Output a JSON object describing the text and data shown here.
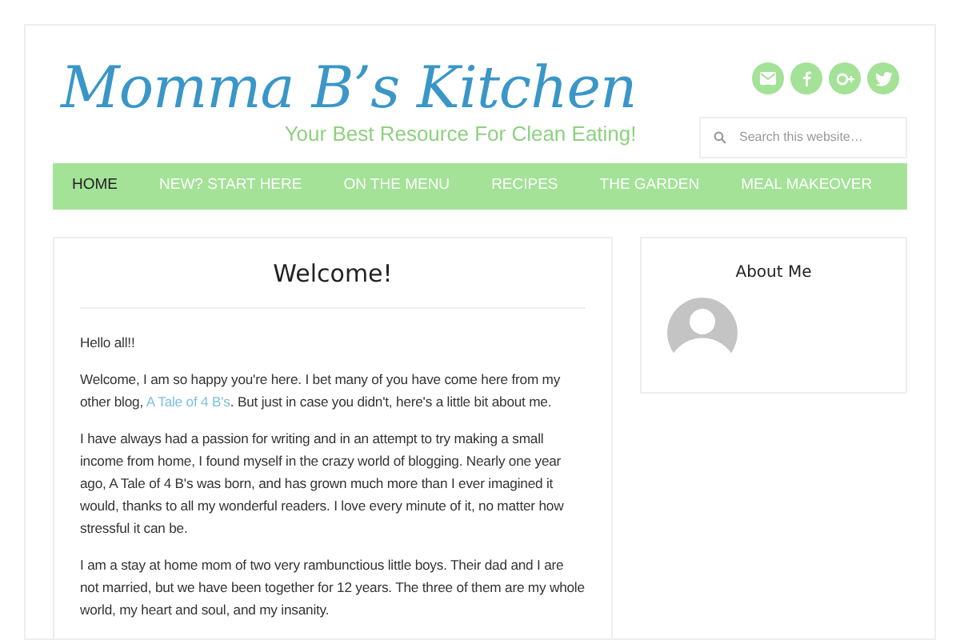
{
  "site": {
    "title": "Momma B’s Kitchen",
    "tagline": "Your Best Resource For Clean Eating!"
  },
  "social": [
    {
      "kind": "email"
    },
    {
      "kind": "facebook"
    },
    {
      "kind": "googleplus"
    },
    {
      "kind": "twitter"
    }
  ],
  "search": {
    "placeholder": "Search this website…"
  },
  "nav": [
    {
      "label": "HOME",
      "selected": true
    },
    {
      "label": "NEW? START HERE",
      "selected": false
    },
    {
      "label": "ON THE MENU",
      "selected": false
    },
    {
      "label": "RECIPES",
      "selected": false
    },
    {
      "label": "THE GARDEN",
      "selected": false
    },
    {
      "label": "MEAL MAKEOVER",
      "selected": false
    }
  ],
  "post": {
    "title": "Welcome!",
    "paragraphs": [
      [
        {
          "kind": "text",
          "text": "Hello all!!"
        }
      ],
      [
        {
          "kind": "text",
          "text": "Welcome, I am so happy you're here. I bet many of you have come here from my other blog, "
        },
        {
          "kind": "link",
          "text": "A Tale of 4 B's"
        },
        {
          "kind": "text",
          "text": ". But just in case you didn't, here's a little bit about me."
        }
      ],
      [
        {
          "kind": "text",
          "text": "I have always had a passion for writing and in an attempt to try making a small income from home, I found myself in the crazy world of blogging. Nearly one year ago, A Tale of 4 B's was born, and has grown much more than I ever imagined it would, thanks to all my wonderful readers. I love every minute of it, no matter how stressful it can be."
        }
      ],
      [
        {
          "kind": "text",
          "text": "I am a stay at home mom of two very rambunctious little boys. Their dad and I are not married, but we have been together for 12 years. The three of them are my whole world, my heart and soul, and my insanity."
        }
      ]
    ]
  },
  "sidebar": {
    "title": "About Me"
  }
}
